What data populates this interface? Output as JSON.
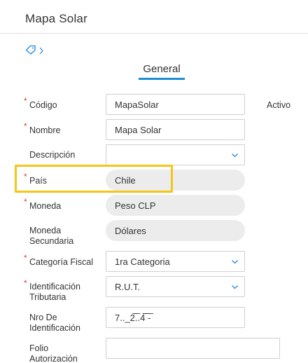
{
  "header": {
    "title": "Mapa Solar"
  },
  "nav": {
    "icon": "tag-icon",
    "chevron": "chevron-right-icon"
  },
  "tabs": [
    {
      "label": "General"
    }
  ],
  "form": {
    "codigo": {
      "label": "Código",
      "value": "MapaSolar",
      "required": "*"
    },
    "activo": {
      "label": "Activo"
    },
    "nombre": {
      "label": "Nombre",
      "value": "Mapa Solar",
      "required": "*"
    },
    "descripcion": {
      "label": "Descripción",
      "value": ""
    },
    "pais": {
      "label": "País",
      "value": "Chile",
      "required": "*"
    },
    "moneda": {
      "label": "Moneda",
      "value": "Peso CLP",
      "required": "*"
    },
    "moneda_secundaria": {
      "label_line1": "Moneda",
      "label_line2": "Secundaria",
      "value": "Dólares"
    },
    "categoria_fiscal": {
      "label": "Categoría Fiscal",
      "value": "1ra Categoria",
      "required": "*"
    },
    "identificacion_tributaria": {
      "label_line1": "Identificación",
      "label_line2": "Tributaria",
      "value": "R.U.T.",
      "required": "*"
    },
    "nro_identificacion": {
      "label_line1": "Nro De",
      "label_line2": "Identificación",
      "value": "7.._2̅.̅.4̅̅ ̅-̅"
    },
    "folio_autorizacion": {
      "label_line1": "Folio",
      "label_line2": "Autorización",
      "value": ""
    }
  },
  "colors": {
    "accent": "#1a8fd1",
    "highlight": "#f5c518",
    "required": "#e53935"
  }
}
